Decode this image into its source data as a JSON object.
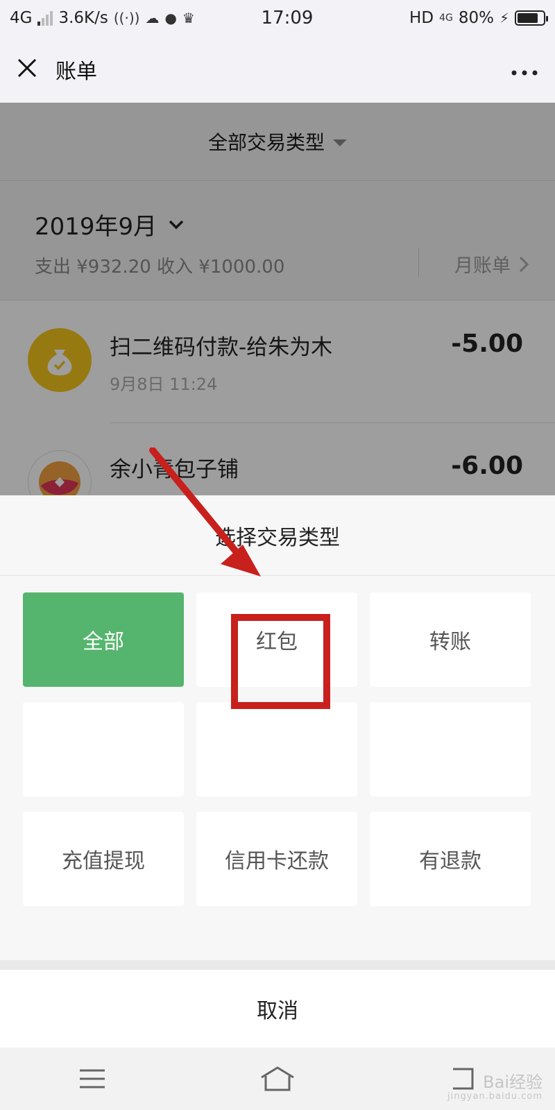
{
  "status_bar": {
    "network": "4G",
    "speed": "3.6K/s",
    "time": "17:09",
    "hd": "HD",
    "net_right": "4G",
    "battery": "80%",
    "battery_level": 0.8
  },
  "nav": {
    "title": "账单"
  },
  "filter": {
    "label": "全部交易类型"
  },
  "summary": {
    "month": "2019年9月",
    "totals": "支出 ¥932.20 收入 ¥1000.00",
    "monthly_bill": "月账单"
  },
  "transactions": [
    {
      "name": "扫二维码付款-给朱为木",
      "time": "9月8日 11:24",
      "amount": "-5.00"
    },
    {
      "name": "余小青包子铺",
      "amount": "-6.00"
    }
  ],
  "sheet": {
    "title": "选择交易类型",
    "options": [
      {
        "label": "全部",
        "selected": true
      },
      {
        "label": "红包"
      },
      {
        "label": "转账"
      },
      {
        "label": ""
      },
      {
        "label": ""
      },
      {
        "label": ""
      },
      {
        "label": "充值提现"
      },
      {
        "label": "信用卡还款"
      },
      {
        "label": "有退款"
      }
    ],
    "cancel": "取消"
  },
  "colors": {
    "selected": "#55b46d",
    "annotation": "#c8201c",
    "coin": "#f2c51c"
  },
  "watermark": {
    "text": "Bai经验",
    "sub": "jingyan.baidu.com"
  }
}
